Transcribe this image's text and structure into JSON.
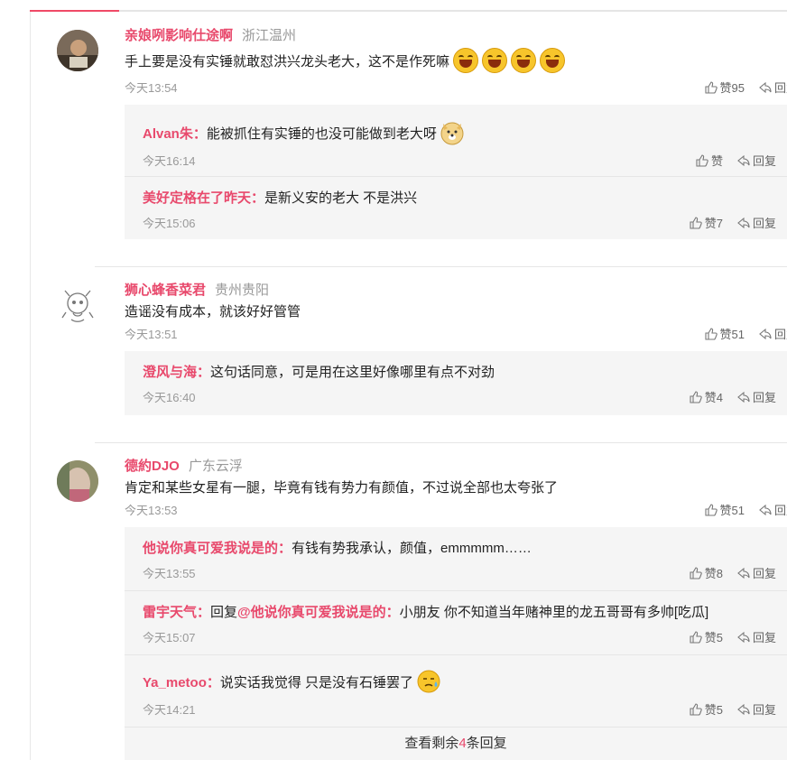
{
  "icons": {
    "like": "thumbs-up-icon",
    "reply": "reply-arrow-icon"
  },
  "colors": {
    "accent": "#e8496c",
    "meta": "#999999",
    "reply_bg": "#f5f5f5"
  },
  "comments": [
    {
      "author": "亲娘咧影响仕途啊",
      "location": "浙江温州",
      "text": "手上要是没有实锤就敢怼洪兴龙头老大，这不是作死嘛",
      "emojis": 4,
      "time": "今天13:54",
      "like": "赞95",
      "reply": "回复",
      "replies": [
        {
          "name": "Alvan朱：",
          "text": "能被抓住有实锤的也没可能做到老大呀",
          "time": "今天16:14",
          "like": "赞",
          "reply": "回复"
        },
        {
          "name": "美好定格在了昨天：",
          "text": "是新义安的老大  不是洪兴",
          "time": "今天15:06",
          "like": "赞7",
          "reply": "回复"
        }
      ]
    },
    {
      "author": "狮心蜂香菜君",
      "location": "贵州贵阳",
      "text": "造谣没有成本，就该好好管管",
      "time": "今天13:51",
      "like": "赞51",
      "reply": "回复",
      "replies": [
        {
          "name": "澄风与海：",
          "text": "这句话同意，可是用在这里好像哪里有点不对劲",
          "time": "今天16:40",
          "like": "赞4",
          "reply": "回复"
        }
      ]
    },
    {
      "author": "德約DJO",
      "location": "广东云浮",
      "text": "肯定和某些女星有一腿，毕竟有钱有势力有颜值，不过说全部也太夸张了",
      "time": "今天13:53",
      "like": "赞51",
      "reply": "回复",
      "replies": [
        {
          "name": "他说你真可爱我说是的：",
          "text": "有钱有势我承认，颜值，emmmmm……",
          "time": "今天13:55",
          "like": "赞8",
          "reply": "回复"
        },
        {
          "name": "雷宇天气：",
          "prefix": "回复",
          "mention": "@他说你真可爱我说是的：",
          "text": "小朋友 你不知道当年赌神里的龙五哥哥有多帅[吃瓜]",
          "time": "今天15:07",
          "like": "赞5",
          "reply": "回复"
        },
        {
          "name": "Ya_metoo：",
          "text": "说实话我觉得 只是没有石锤罢了",
          "time": "今天14:21",
          "like": "赞5",
          "reply": "回复"
        }
      ],
      "more": {
        "before": "查看剩余",
        "count": "4",
        "after": "条回复"
      }
    }
  ]
}
